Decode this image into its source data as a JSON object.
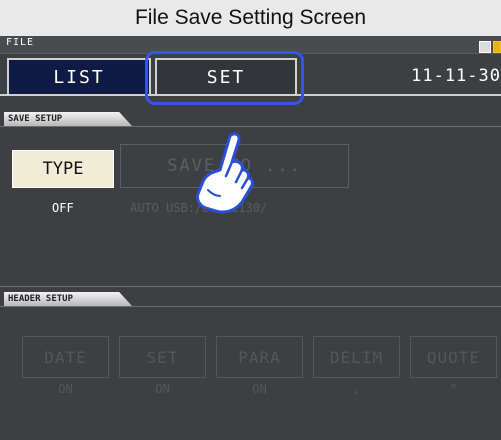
{
  "caption": "File Save Setting Screen",
  "topbar": {
    "title": "FILE"
  },
  "tabs": {
    "list": "LIST",
    "set": "SET"
  },
  "date": "11-11-30",
  "save_setup": {
    "label": "SAVE SETUP",
    "type_button": "TYPE",
    "type_value": "OFF",
    "save_to_button": "SAVE TO ...",
    "save_to_value": "AUTO  USB:/20111130/"
  },
  "header_setup": {
    "label": "HEADER SETUP",
    "buttons": [
      {
        "label": "DATE",
        "value": "ON"
      },
      {
        "label": "SET",
        "value": "ON"
      },
      {
        "label": "PARA",
        "value": "ON"
      },
      {
        "label": "DELIM",
        "value": ","
      },
      {
        "label": "QUOTE",
        "value": "\""
      }
    ]
  },
  "colors": {
    "highlight": "#3355ee",
    "screen_bg": "#3e3f42",
    "type_button_bg": "#f1ecd6"
  },
  "icons": [
    "pointing-hand-icon",
    "status-icons"
  ]
}
